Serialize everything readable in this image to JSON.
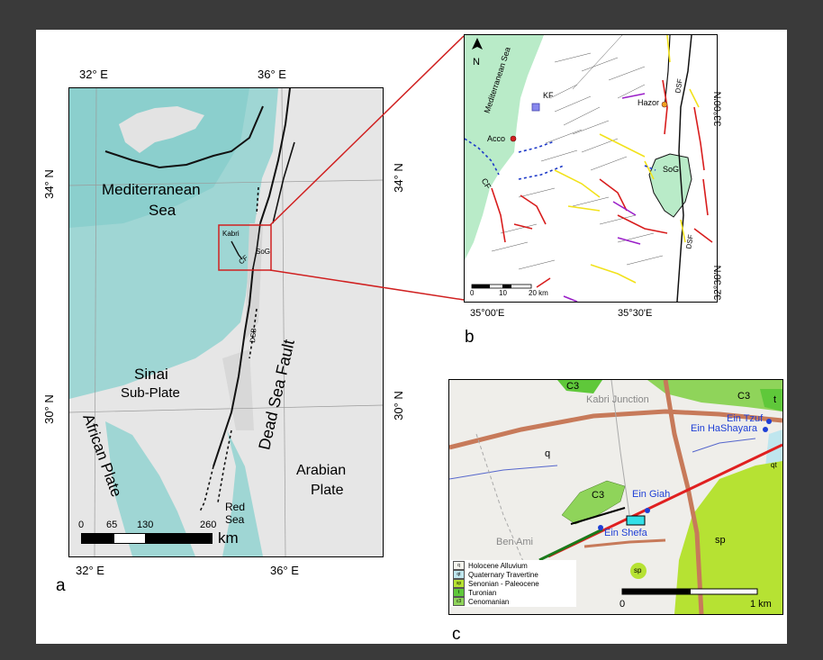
{
  "panel_a": {
    "panel_letter": "a",
    "coords": {
      "lon_32_top": "32° E",
      "lon_36_top": "36° E",
      "lon_32_bottom": "32° E",
      "lon_36_bottom": "36° E",
      "lat_34_left": "34° N",
      "lat_30_left": "30° N",
      "lat_34_right": "34° N",
      "lat_30_right": "30° N"
    },
    "labels": {
      "med_sea_1": "Mediterranean",
      "med_sea_2": "Sea",
      "sinai_1": "Sinai",
      "sinai_2": "Sub-Plate",
      "african": "African Plate",
      "dead_sea_fault": "Dead Sea Fault",
      "arabian_1": "Arabian",
      "arabian_2": "Plate",
      "red_sea_1": "Red",
      "red_sea_2": "Sea",
      "kabri": "Kabri",
      "sog": "SoG",
      "cf": "CF",
      "dsb": "DSB"
    },
    "scale": {
      "t0": "0",
      "t1": "65",
      "t2": "130",
      "t3": "260",
      "unit": "km"
    }
  },
  "panel_b": {
    "panel_letter": "b",
    "labels": {
      "north": "N",
      "med_sea": "Mediterranean Sea",
      "kf": "KF",
      "hazor": "Hazor",
      "acco": "Acco",
      "sog": "SoG",
      "cf": "CF",
      "dsf_top": "DSF",
      "dsf_bottom": "DSF"
    },
    "coords": {
      "lon_1": "35°00'E",
      "lon_2": "35°30'E",
      "lat_1": "33°00'N",
      "lat_2": "32°30'N"
    },
    "scale": {
      "t0": "0",
      "t1": "10",
      "t2": "20 km"
    }
  },
  "panel_c": {
    "panel_letter": "c",
    "labels": {
      "c3_top": "C3",
      "kabri_junction": "Kabri Junction",
      "c3_right": "C3",
      "t": "t",
      "ein_tzuf": "Ein Tzuf",
      "ein_hashayara": "Ein HaShayara",
      "q": "q",
      "qt": "qt",
      "c3_mid": "C3",
      "ein_giah": "Ein Giah",
      "ein_shefa": "Ein Shefa",
      "ben_ami": "Ben Ami",
      "sp_right": "sp",
      "sp_bottom": "sp"
    },
    "legend": [
      {
        "code": "q",
        "label": "Holocene Alluvium",
        "color": "#f4f4ee"
      },
      {
        "code": "qt",
        "label": "Quaternary Travertine",
        "color": "#bfe6ee"
      },
      {
        "code": "sp",
        "label": "Senonian - Paleocene",
        "color": "#b6e233"
      },
      {
        "code": "t",
        "label": "Turonian",
        "color": "#5fc83a"
      },
      {
        "code": "c3",
        "label": "Cenomanian",
        "color": "#8fd45a"
      }
    ],
    "scale": {
      "t0": "0",
      "t1": "1 km"
    }
  }
}
